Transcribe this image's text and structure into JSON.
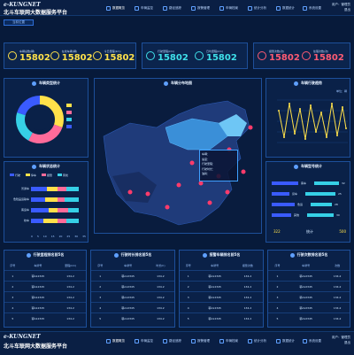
{
  "app": {
    "logo": "e-KUNGNET",
    "title": "北斗车联网大数据服务平台",
    "user_line1": "用户：管理员",
    "user_line2": "退出"
  },
  "nav": [
    {
      "label": "数据概览"
    },
    {
      "label": "车辆监控"
    },
    {
      "label": "路径追踪"
    },
    {
      "label": "报警管理"
    },
    {
      "label": "车辆档案"
    },
    {
      "label": "统计分析"
    },
    {
      "label": "数据统计"
    },
    {
      "label": "系统设置"
    }
  ],
  "breadcrumb": "当前位置",
  "kpi": [
    {
      "label": "车辆总数(辆)",
      "value": "15802",
      "color": "#ffe14a"
    },
    {
      "label": "在线车辆(辆)",
      "value": "15802",
      "color": "#ffe14a"
    },
    {
      "label": "今日里程(km)",
      "value": "15802",
      "color": "#ffe14a"
    },
    {
      "label": "行驶里程(km)",
      "value": "15802",
      "color": "#3fe0ea"
    },
    {
      "label": "日均里程(km)",
      "value": "15802",
      "color": "#3fe0ea"
    },
    {
      "label": "报警次数(次)",
      "value": "15802",
      "color": "#ff5b73"
    },
    {
      "label": "处理次数(次)",
      "value": "15802",
      "color": "#ff5b73"
    }
  ],
  "panels": {
    "type_stats": "车辆类型统计",
    "map": "车辆分布地图",
    "trend": "车辆行驶趋势",
    "status_stats": "车辆状态统计",
    "model_stats": "车辆型号统计",
    "trend_legend": "单位：辆"
  },
  "tooltip": {
    "lines": [
      "车辆：",
      "速度：",
      "行驶里程：",
      "行驶时长：",
      "油耗："
    ]
  },
  "status_legend": [
    "行驶",
    "停车",
    "报警",
    "离线"
  ],
  "status_categories": [
    "普通车",
    "危险品运输车",
    "客运车",
    "校车"
  ],
  "status_axis": [
    "0",
    "5",
    "10",
    "15",
    "20",
    "25",
    "30",
    "35"
  ],
  "model_bars": [
    {
      "label": "客车",
      "value": "32"
    },
    {
      "label": "货车",
      "value": "25"
    },
    {
      "label": "危运",
      "value": "28"
    },
    {
      "label": "其他",
      "value": "30"
    }
  ],
  "model_totals": [
    "322",
    "统计",
    "500"
  ],
  "tables": [
    {
      "title": "行驶里程排名前5名",
      "headers": [
        "序号",
        "车牌号",
        "里程(km)"
      ],
      "rows": [
        [
          "1",
          "鄂A12345",
          "134.2"
        ],
        [
          "2",
          "鄂A12345",
          "134.2"
        ],
        [
          "3",
          "鄂A12345",
          "134.2"
        ],
        [
          "4",
          "鄂A12345",
          "134.2"
        ],
        [
          "5",
          "鄂A12345",
          "134.2"
        ]
      ]
    },
    {
      "title": "行驶时长排名前5名",
      "headers": [
        "序号",
        "车牌号",
        "时长(h)"
      ],
      "rows": [
        [
          "1",
          "鄂A12345",
          "134.2"
        ],
        [
          "2",
          "鄂A12345",
          "134.2"
        ],
        [
          "3",
          "鄂A12345",
          "134.2"
        ],
        [
          "4",
          "鄂A12345",
          "134.2"
        ],
        [
          "5",
          "鄂A12345",
          "134.2"
        ]
      ]
    },
    {
      "title": "报警车辆排名前5名",
      "headers": [
        "序号",
        "车牌号",
        "报警次数"
      ],
      "rows": [
        [
          "1",
          "鄂A12345",
          "134.2"
        ],
        [
          "2",
          "鄂A12345",
          "134.2"
        ],
        [
          "3",
          "鄂A12345",
          "134.2"
        ],
        [
          "4",
          "鄂A12345",
          "134.2"
        ],
        [
          "5",
          "鄂A12345",
          "134.2"
        ]
      ]
    },
    {
      "title": "行驶次数排名前5名",
      "headers": [
        "序号",
        "车牌号",
        "次数"
      ],
      "rows": [
        [
          "1",
          "鄂A12345",
          "134.2"
        ],
        [
          "2",
          "鄂A12345",
          "134.2"
        ],
        [
          "3",
          "鄂A12345",
          "134.2"
        ],
        [
          "4",
          "鄂A12345",
          "134.2"
        ],
        [
          "5",
          "鄂A12345",
          "134.2"
        ]
      ]
    }
  ],
  "colors": {
    "accent": "#3fe0ea",
    "panel": "#0a2148",
    "border": "#1d4f9a",
    "alert": "#ff3b6b",
    "gold": "#ffe14a"
  }
}
